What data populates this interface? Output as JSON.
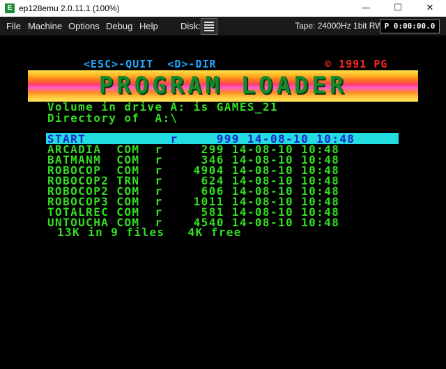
{
  "window": {
    "title": "ep128emu 2.0.11.1 (100%)",
    "icon_letter": "E",
    "controls": {
      "minimize": "—",
      "maximize": "☐",
      "close": "✕"
    }
  },
  "menu": {
    "items": [
      "File",
      "Machine",
      "Options",
      "Debug",
      "Help"
    ],
    "disk_label": "Disk:",
    "tape_status": "Tape: 24000Hz 1bit RW",
    "tape_counter": "P 0:00:00.0"
  },
  "screen": {
    "header": "<ESC>-QUIT  <D>-DIR",
    "copyright": "© 1991 PG",
    "banner": "PROGRAM LOADER",
    "volume_line": "Volume in drive A: is GAMES_21",
    "directory_line": "Directory of  A:\\",
    "files": [
      "START           r     999 14-08-10 10:48",
      "ARCADIA  COM  r     299 14-08-10 10:48",
      "BATMANM  COM  r     346 14-08-10 10:48",
      "ROBOCOP  COM  r    4904 14-08-10 10:48",
      "ROBOCOP2 TRN  r     624 14-08-10 10:48",
      "ROBOCOP2 COM  r     606 14-08-10 10:48",
      "ROBOCOP3 COM  r    1011 14-08-10 10:48",
      "TOTALREC COM  r     581 14-08-10 10:48",
      "UNTOUCHA COM  r    4540 14-08-10 10:48"
    ],
    "summary": "13K in 9 files   4K free"
  }
}
